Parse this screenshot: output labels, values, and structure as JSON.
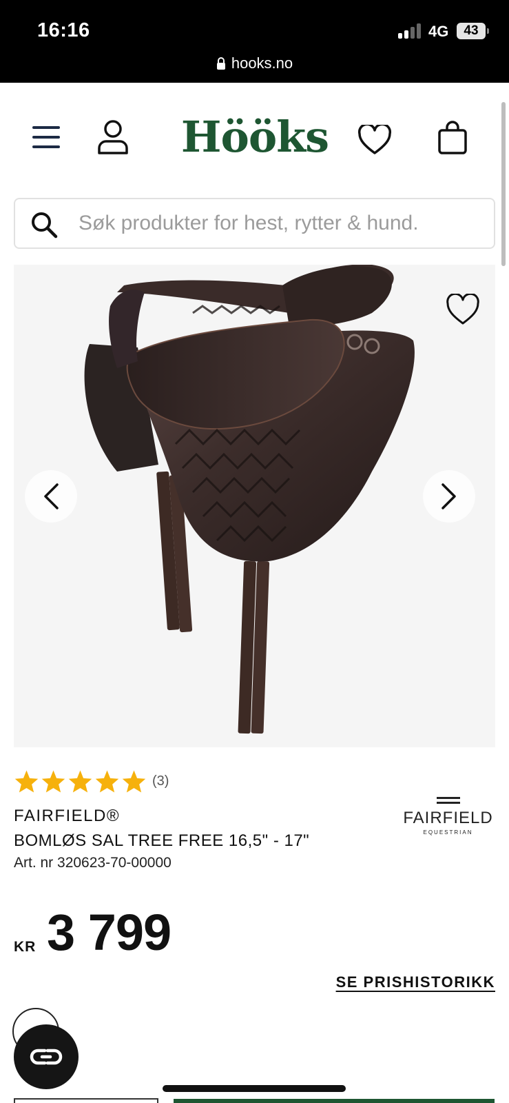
{
  "status_bar": {
    "time": "16:16",
    "network": "4G",
    "battery": "43",
    "url": "hooks.no"
  },
  "header": {
    "logo": "Hööks",
    "icons": [
      "menu-icon",
      "account-icon",
      "wishlist-icon",
      "cart-icon"
    ]
  },
  "search": {
    "placeholder": "Søk produkter for hest, rytter & hund."
  },
  "product": {
    "rating_stars": 5,
    "review_count": "(3)",
    "brand": "FAIRFIELD®",
    "name": "BOMLØS SAL TREE FREE 16,5\" - 17\"",
    "art_nr": "Art. nr 320623-70-00000",
    "brand_logo": {
      "main": "FAIRFIELD",
      "sub": "EQUESTRIAN"
    },
    "currency": "KR",
    "price": "3 799",
    "price_history_link": "SE PRISHISTORIKK"
  },
  "colors": {
    "brand_green": "#1e5632",
    "star": "#f6b10c",
    "saddle_leather": "#3a2a27"
  }
}
